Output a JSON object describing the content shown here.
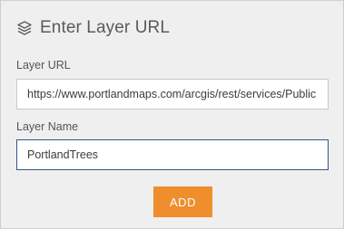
{
  "dialog": {
    "title": "Enter Layer URL",
    "icon": "layers-icon"
  },
  "layer_url": {
    "label": "Layer URL",
    "value": "https://www.portlandmaps.com/arcgis/rest/services/Public"
  },
  "layer_name": {
    "label": "Layer Name",
    "value": "PortlandTrees"
  },
  "add_button": {
    "label": "ADD"
  },
  "colors": {
    "accent": "#ef8e2c",
    "focus_border": "#37558a",
    "panel_bg": "#efefef"
  }
}
